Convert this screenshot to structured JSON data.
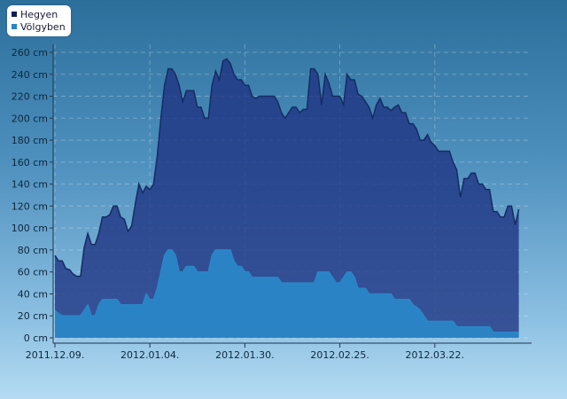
{
  "chart_data": {
    "type": "area",
    "x_ticks": [
      "2011.12.09.",
      "2012.01.04.",
      "2012.01.30.",
      "2012.02.25.",
      "2012.03.22."
    ],
    "y_ticks": [
      "0 cm",
      "20 cm",
      "40 cm",
      "60 cm",
      "80 cm",
      "100 cm",
      "120 cm",
      "140 cm",
      "160 cm",
      "180 cm",
      "200 cm",
      "220 cm",
      "240 cm",
      "260 cm"
    ],
    "ylim": [
      0,
      260
    ],
    "day_range": [
      0,
      130
    ],
    "grid": true,
    "legend_position": "top-left",
    "series": [
      {
        "name": "Hegyen",
        "color": "#1e3a78",
        "points": [
          [
            0,
            75
          ],
          [
            1,
            70
          ],
          [
            2,
            70
          ],
          [
            3,
            63
          ],
          [
            4,
            62
          ],
          [
            5,
            58
          ],
          [
            6,
            56
          ],
          [
            7,
            56
          ],
          [
            8,
            82
          ],
          [
            9,
            95
          ],
          [
            10,
            85
          ],
          [
            11,
            85
          ],
          [
            12,
            95
          ],
          [
            13,
            110
          ],
          [
            14,
            110
          ],
          [
            15,
            112
          ],
          [
            16,
            120
          ],
          [
            17,
            120
          ],
          [
            18,
            110
          ],
          [
            19,
            108
          ],
          [
            20,
            97
          ],
          [
            21,
            102
          ],
          [
            22,
            122
          ],
          [
            23,
            140
          ],
          [
            24,
            132
          ],
          [
            25,
            138
          ],
          [
            26,
            135
          ],
          [
            27,
            140
          ],
          [
            28,
            165
          ],
          [
            29,
            200
          ],
          [
            30,
            230
          ],
          [
            31,
            245
          ],
          [
            32,
            245
          ],
          [
            33,
            240
          ],
          [
            34,
            230
          ],
          [
            35,
            215
          ],
          [
            36,
            225
          ],
          [
            37,
            225
          ],
          [
            38,
            225
          ],
          [
            39,
            210
          ],
          [
            40,
            210
          ],
          [
            41,
            200
          ],
          [
            42,
            200
          ],
          [
            43,
            230
          ],
          [
            44,
            243
          ],
          [
            45,
            235
          ],
          [
            46,
            252
          ],
          [
            47,
            254
          ],
          [
            48,
            250
          ],
          [
            49,
            240
          ],
          [
            50,
            235
          ],
          [
            51,
            235
          ],
          [
            52,
            230
          ],
          [
            53,
            230
          ],
          [
            54,
            220
          ],
          [
            55,
            218
          ],
          [
            56,
            220
          ],
          [
            57,
            220
          ],
          [
            58,
            220
          ],
          [
            59,
            220
          ],
          [
            60,
            220
          ],
          [
            61,
            215
          ],
          [
            62,
            205
          ],
          [
            63,
            200
          ],
          [
            64,
            205
          ],
          [
            65,
            210
          ],
          [
            66,
            210
          ],
          [
            67,
            205
          ],
          [
            68,
            208
          ],
          [
            69,
            208
          ],
          [
            70,
            245
          ],
          [
            71,
            245
          ],
          [
            72,
            240
          ],
          [
            73,
            212
          ],
          [
            74,
            240
          ],
          [
            75,
            232
          ],
          [
            76,
            220
          ],
          [
            77,
            220
          ],
          [
            78,
            220
          ],
          [
            79,
            212
          ],
          [
            80,
            240
          ],
          [
            81,
            235
          ],
          [
            82,
            235
          ],
          [
            83,
            222
          ],
          [
            84,
            220
          ],
          [
            85,
            215
          ],
          [
            86,
            210
          ],
          [
            87,
            200
          ],
          [
            88,
            212
          ],
          [
            89,
            218
          ],
          [
            90,
            210
          ],
          [
            91,
            210
          ],
          [
            92,
            207
          ],
          [
            93,
            210
          ],
          [
            94,
            212
          ],
          [
            95,
            205
          ],
          [
            96,
            205
          ],
          [
            97,
            195
          ],
          [
            98,
            195
          ],
          [
            99,
            190
          ],
          [
            100,
            180
          ],
          [
            101,
            180
          ],
          [
            102,
            185
          ],
          [
            103,
            178
          ],
          [
            104,
            175
          ],
          [
            105,
            170
          ],
          [
            106,
            170
          ],
          [
            107,
            170
          ],
          [
            108,
            170
          ],
          [
            109,
            160
          ],
          [
            110,
            153
          ],
          [
            111,
            128
          ],
          [
            112,
            145
          ],
          [
            113,
            145
          ],
          [
            114,
            150
          ],
          [
            115,
            150
          ],
          [
            116,
            140
          ],
          [
            117,
            140
          ],
          [
            118,
            135
          ],
          [
            119,
            135
          ],
          [
            120,
            115
          ],
          [
            121,
            115
          ],
          [
            122,
            110
          ],
          [
            123,
            110
          ],
          [
            124,
            120
          ],
          [
            125,
            120
          ],
          [
            126,
            103
          ],
          [
            127,
            117
          ]
        ]
      },
      {
        "name": "Völgyben",
        "color": "#2a86c6",
        "points": [
          [
            0,
            25
          ],
          [
            1,
            22
          ],
          [
            2,
            20
          ],
          [
            3,
            20
          ],
          [
            4,
            20
          ],
          [
            5,
            20
          ],
          [
            6,
            20
          ],
          [
            7,
            20
          ],
          [
            8,
            25
          ],
          [
            9,
            30
          ],
          [
            10,
            20
          ],
          [
            11,
            20
          ],
          [
            12,
            30
          ],
          [
            13,
            35
          ],
          [
            14,
            35
          ],
          [
            15,
            35
          ],
          [
            16,
            35
          ],
          [
            17,
            35
          ],
          [
            18,
            30
          ],
          [
            19,
            30
          ],
          [
            20,
            30
          ],
          [
            21,
            30
          ],
          [
            22,
            30
          ],
          [
            23,
            30
          ],
          [
            24,
            30
          ],
          [
            25,
            40
          ],
          [
            26,
            35
          ],
          [
            27,
            35
          ],
          [
            28,
            45
          ],
          [
            29,
            60
          ],
          [
            30,
            75
          ],
          [
            31,
            80
          ],
          [
            32,
            80
          ],
          [
            33,
            75
          ],
          [
            34,
            60
          ],
          [
            35,
            60
          ],
          [
            36,
            65
          ],
          [
            37,
            65
          ],
          [
            38,
            65
          ],
          [
            39,
            60
          ],
          [
            40,
            60
          ],
          [
            41,
            60
          ],
          [
            42,
            60
          ],
          [
            43,
            75
          ],
          [
            44,
            80
          ],
          [
            45,
            80
          ],
          [
            46,
            80
          ],
          [
            47,
            80
          ],
          [
            48,
            80
          ],
          [
            49,
            70
          ],
          [
            50,
            65
          ],
          [
            51,
            65
          ],
          [
            52,
            60
          ],
          [
            53,
            60
          ],
          [
            54,
            55
          ],
          [
            55,
            55
          ],
          [
            56,
            55
          ],
          [
            57,
            55
          ],
          [
            58,
            55
          ],
          [
            59,
            55
          ],
          [
            60,
            55
          ],
          [
            61,
            55
          ],
          [
            62,
            50
          ],
          [
            63,
            50
          ],
          [
            64,
            50
          ],
          [
            65,
            50
          ],
          [
            66,
            50
          ],
          [
            67,
            50
          ],
          [
            68,
            50
          ],
          [
            69,
            50
          ],
          [
            70,
            50
          ],
          [
            71,
            50
          ],
          [
            72,
            60
          ],
          [
            73,
            60
          ],
          [
            74,
            60
          ],
          [
            75,
            60
          ],
          [
            76,
            55
          ],
          [
            77,
            50
          ],
          [
            78,
            50
          ],
          [
            79,
            55
          ],
          [
            80,
            60
          ],
          [
            81,
            60
          ],
          [
            82,
            55
          ],
          [
            83,
            45
          ],
          [
            84,
            45
          ],
          [
            85,
            45
          ],
          [
            86,
            40
          ],
          [
            87,
            40
          ],
          [
            88,
            40
          ],
          [
            89,
            40
          ],
          [
            90,
            40
          ],
          [
            91,
            40
          ],
          [
            92,
            40
          ],
          [
            93,
            35
          ],
          [
            94,
            35
          ],
          [
            95,
            35
          ],
          [
            96,
            35
          ],
          [
            97,
            35
          ],
          [
            98,
            30
          ],
          [
            99,
            28
          ],
          [
            100,
            25
          ],
          [
            101,
            20
          ],
          [
            102,
            15
          ],
          [
            103,
            15
          ],
          [
            104,
            15
          ],
          [
            105,
            15
          ],
          [
            106,
            15
          ],
          [
            107,
            15
          ],
          [
            108,
            15
          ],
          [
            109,
            15
          ],
          [
            110,
            10
          ],
          [
            111,
            10
          ],
          [
            112,
            10
          ],
          [
            113,
            10
          ],
          [
            114,
            10
          ],
          [
            115,
            10
          ],
          [
            116,
            10
          ],
          [
            117,
            10
          ],
          [
            118,
            10
          ],
          [
            119,
            10
          ],
          [
            120,
            5
          ],
          [
            121,
            5
          ],
          [
            122,
            5
          ],
          [
            123,
            5
          ],
          [
            124,
            5
          ],
          [
            125,
            5
          ],
          [
            126,
            5
          ],
          [
            127,
            5
          ]
        ]
      }
    ]
  }
}
